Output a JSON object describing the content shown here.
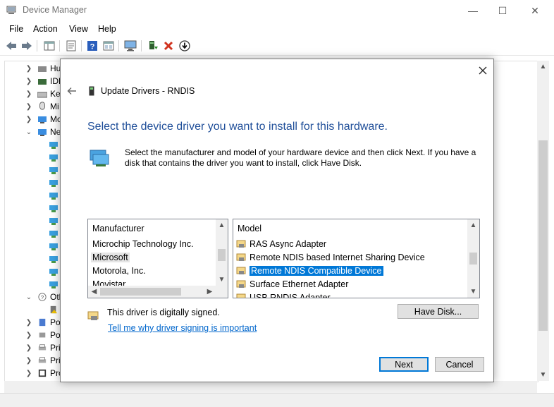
{
  "window": {
    "title": "Device Manager",
    "minimize_glyph": "—",
    "maximize_glyph": "☐",
    "close_glyph": "✕"
  },
  "menu": [
    "File",
    "Action",
    "View",
    "Help"
  ],
  "tree": {
    "partial_labels": [
      "Hu",
      "IDE",
      "Ke",
      "Mi",
      "Mo",
      "Ne",
      "Oth",
      "Po",
      "Po",
      "Pri",
      "Pri",
      "Pro"
    ]
  },
  "dialog": {
    "title": "Update Drivers - RNDIS",
    "heading": "Select the device driver you want to install for this hardware.",
    "instructions": "Select the manufacturer and model of your hardware device and then click Next. If you have a disk that contains the driver you want to install, click Have Disk.",
    "manufacturer": {
      "header": "Manufacturer",
      "items": [
        "Microchip Technology Inc.",
        "Microsoft",
        "Motorola, Inc.",
        "Movistar"
      ],
      "selected": "Microsoft"
    },
    "model": {
      "header": "Model",
      "items": [
        "RAS Async Adapter",
        "Remote NDIS based Internet Sharing Device",
        "Remote NDIS Compatible Device",
        "Surface Ethernet Adapter",
        "USB RNDIS Adapter"
      ],
      "selected": "Remote NDIS Compatible Device"
    },
    "signed_text": "This driver is digitally signed.",
    "signing_link": "Tell me why driver signing is important",
    "have_disk_label": "Have Disk...",
    "next_label": "Next",
    "cancel_label": "Cancel"
  },
  "colors": {
    "heading": "#1f4e99",
    "selection": "#0078d7",
    "link": "#0066cc"
  }
}
